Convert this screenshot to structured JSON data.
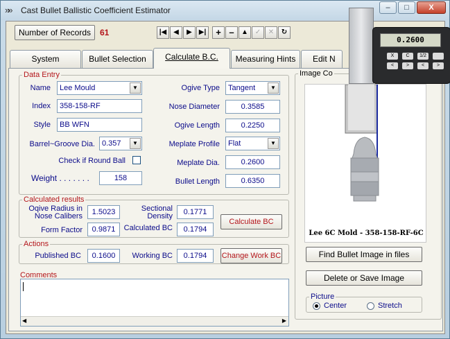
{
  "window": {
    "title": "Cast Bullet Ballistic Coefficient Estimator",
    "caption": {
      "minimize": "–",
      "maximize": "□",
      "close": "X"
    }
  },
  "toolbar": {
    "records_button": "Number of Records",
    "records_count": "61",
    "nav": [
      "|◀",
      "◀",
      "▶",
      "▶|",
      "+",
      "–",
      "▲",
      "✓",
      "✕",
      "↻"
    ]
  },
  "tabs": [
    {
      "label": "System"
    },
    {
      "label": "Bullet Selection"
    },
    {
      "label": "Calculate B.C."
    },
    {
      "label": "Measuring Hints"
    },
    {
      "label": "Edit N"
    }
  ],
  "data_entry": {
    "legend": "Data Entry",
    "name_label": "Name",
    "name_value": "Lee Mould",
    "index_label": "Index",
    "index_value": "358-158-RF",
    "style_label": "Style",
    "style_value": "BB WFN",
    "barrel_label": "Barrel~Groove Dia.",
    "barrel_value": "0.357",
    "roundball_label": "Check if Round Ball",
    "weight_label": "Weight . . . . . . .",
    "weight_value": "158",
    "ogive_type_label": "Ogive Type",
    "ogive_type_value": "Tangent",
    "nose_diameter_label": "Nose Diameter",
    "nose_diameter_value": "0.3585",
    "ogive_length_label": "Ogive Length",
    "ogive_length_value": "0.2250",
    "meplate_profile_label": "Meplate Profile",
    "meplate_profile_value": "Flat",
    "meplate_dia_label": "Meplate Dia.",
    "meplate_dia_value": "0.2600",
    "bullet_length_label": "Bullet Length",
    "bullet_length_value": "0.6350"
  },
  "calculated": {
    "legend": "Calculated results",
    "ogive_radius_label_1": "Oqive Radius in",
    "ogive_radius_label_2": "Nose Calibers",
    "ogive_radius_value": "1.5023",
    "sectional_density_label_1": "Sectional",
    "sectional_density_label_2": "Density",
    "sectional_density_value": "0.1771",
    "form_factor_label": "Form Factor",
    "form_factor_value": "0.9871",
    "calculated_bc_label": "Calculated BC",
    "calculated_bc_value": "0.1794",
    "calculate_button": "Calculate BC"
  },
  "actions": {
    "legend": "Actions",
    "published_bc_label": "Published BC",
    "published_bc_value": "0.1600",
    "working_bc_label": "Working BC",
    "working_bc_value": "0.1794",
    "change_button": "Change Work BC"
  },
  "comments": {
    "label": "Comments",
    "value": ""
  },
  "image_panel": {
    "legend": "Image Co",
    "caption": "Lee 6C Mold - 358-158-RF-6C",
    "caliper_readout": "0.2600",
    "caliper_keys": [
      "X",
      "C",
      "1/2",
      "",
      "<",
      ">",
      "<",
      ">"
    ],
    "find_button": "Find Bullet Image in files",
    "delete_button": "Delete or Save Image",
    "picture_legend": "Picture",
    "center_label": "Center",
    "stretch_label": "Stretch",
    "selected": "Center"
  },
  "colors": {
    "label_blue": "#0b0b8a",
    "legend_red": "#b3151a",
    "count_red": "#b3151a",
    "hints_green": "#0a8a2a"
  }
}
